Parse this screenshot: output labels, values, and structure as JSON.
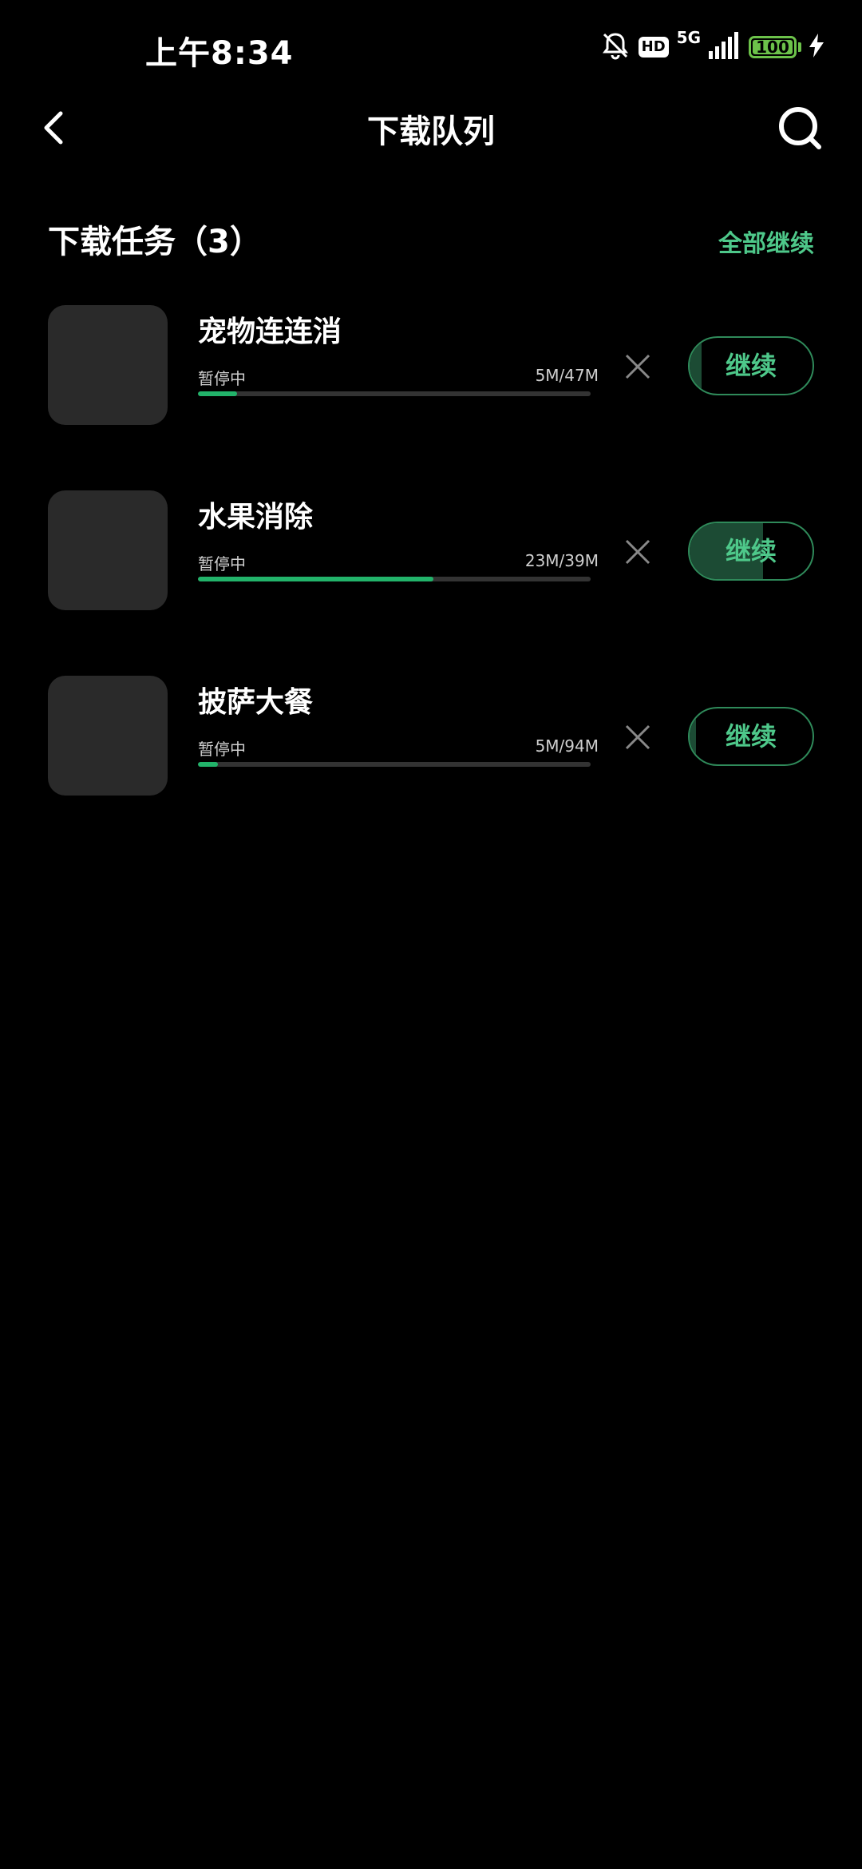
{
  "status_bar": {
    "time": "上午8:34",
    "hd": "HD",
    "network": "5G",
    "battery": "100",
    "icons": [
      "mute-bell-icon",
      "signal-icon",
      "charging-icon"
    ],
    "accent": "#6cc24a"
  },
  "header": {
    "title": "下载队列",
    "back_icon": "chevron-left-icon",
    "search_icon": "search-icon"
  },
  "section": {
    "title": "下载任务（3）",
    "resume_all": "全部继续"
  },
  "colors": {
    "background": "#000000",
    "progress": "#22b36a",
    "accent_text": "#4ec88a"
  },
  "tasks": [
    {
      "name": "宠物连连消",
      "state": "暂停中",
      "size": "5M/47M",
      "progress": 0.1,
      "action": "继续"
    },
    {
      "name": "水果消除",
      "state": "暂停中",
      "size": "23M/39M",
      "progress": 0.6,
      "action": "继续"
    },
    {
      "name": "披萨大餐",
      "state": "暂停中",
      "size": "5M/94M",
      "progress": 0.05,
      "action": "继续"
    }
  ]
}
